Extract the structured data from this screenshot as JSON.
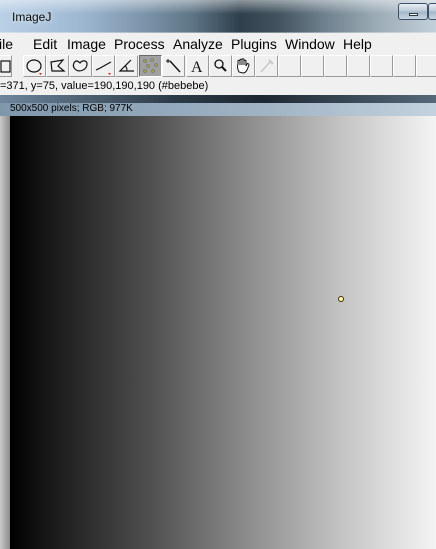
{
  "window": {
    "title": "ImageJ"
  },
  "menu": {
    "items": [
      {
        "label": "ile"
      },
      {
        "label": "Edit"
      },
      {
        "label": "Image"
      },
      {
        "label": "Process"
      },
      {
        "label": "Analyze"
      },
      {
        "label": "Plugins"
      },
      {
        "label": "Window"
      },
      {
        "label": "Help"
      }
    ]
  },
  "toolbar": {
    "tools": [
      {
        "icon": "rectangle-selection-icon"
      },
      {
        "icon": "oval-selection-icon"
      },
      {
        "icon": "polygon-selection-icon"
      },
      {
        "icon": "freehand-selection-icon"
      },
      {
        "icon": "line-selection-icon"
      },
      {
        "icon": "angle-icon"
      },
      {
        "icon": "point-icon",
        "selected": true
      },
      {
        "icon": "wand-icon"
      },
      {
        "icon": "text-icon",
        "glyph": "A"
      },
      {
        "icon": "magnifier-icon"
      },
      {
        "icon": "hand-icon"
      },
      {
        "icon": "color-picker-icon"
      }
    ]
  },
  "status": {
    "text": "=371, y=75, value=190,190,190 (#bebebe)"
  },
  "image": {
    "info": "500x500 pixels; RGB; 977K",
    "gradient_start_color": "#000000",
    "gradient_end_color": "#f4f4f4",
    "cursor_color": "#fff8b0"
  },
  "colors": {
    "selected_tool": "#a0a0a0",
    "window_bg": "#f0f0f0"
  }
}
